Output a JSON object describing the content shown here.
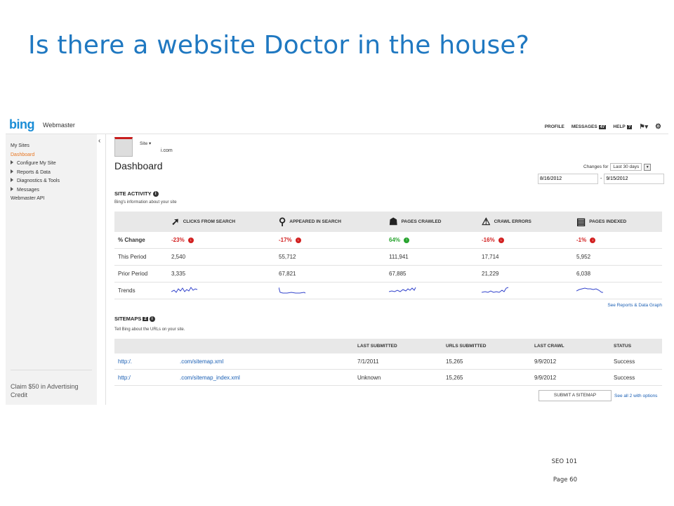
{
  "slide": {
    "title": "Is there a website Doctor in the house?",
    "footer_course": "SEO 101",
    "footer_page": "Page 60"
  },
  "topbar": {
    "logo": "bing",
    "product": "Webmaster",
    "profile": "PROFILE",
    "messages": "MESSAGES",
    "messages_count": "47",
    "help": "HELP",
    "help_badge": "?"
  },
  "sidebar": {
    "items": [
      {
        "label": "My Sites"
      },
      {
        "label": "Dashboard"
      },
      {
        "label": "Configure My Site"
      },
      {
        "label": "Reports & Data"
      },
      {
        "label": "Diagnostics & Tools"
      },
      {
        "label": "Messages"
      },
      {
        "label": "Webmaster API"
      }
    ],
    "claim": "Claim $50 in Advertising Credit"
  },
  "main": {
    "site_label": "Site",
    "site_url": "i.com",
    "page_title": "Dashboard",
    "changes_for": "Changes for",
    "range": "Last 30 days",
    "date_from": "8/16/2012",
    "date_sep": "-",
    "date_to": "9/15/2012"
  },
  "activity": {
    "title": "SITE ACTIVITY",
    "subtitle": "Bing's information about your site",
    "headers": [
      "CLICKS FROM SEARCH",
      "APPEARED IN SEARCH",
      "PAGES CRAWLED",
      "CRAWL ERRORS",
      "PAGES INDEXED"
    ],
    "header_icons": [
      "cursor-icon",
      "magnifier-icon",
      "robot-icon",
      "warning-icon",
      "document-icon"
    ],
    "rows": {
      "pct_label": "% Change",
      "pct": [
        "-23%",
        "-17%",
        "64%",
        "-16%",
        "-1%"
      ],
      "pct_dir": [
        "down",
        "down",
        "up",
        "down",
        "down"
      ],
      "this_label": "This Period",
      "this": [
        "2,540",
        "55,712",
        "111,941",
        "17,714",
        "5,952"
      ],
      "prior_label": "Prior Period",
      "prior": [
        "3,335",
        "67,821",
        "67,885",
        "21,229",
        "6,038"
      ],
      "trends_label": "Trends"
    },
    "see_reports": "See Reports & Data Graph"
  },
  "sitemaps": {
    "title": "SITEMAPS",
    "count": "2",
    "subtitle": "Tell Bing about the URLs on your site.",
    "headers": [
      "",
      "",
      "LAST SUBMITTED",
      "URLS SUBMITTED",
      "LAST CRAWL",
      "STATUS"
    ],
    "rows": [
      [
        "http:/.",
        ".com/sitemap.xml",
        "7/1/2011",
        "15,265",
        "9/9/2012",
        "Success"
      ],
      [
        "http:/",
        ".com/sitemap_index.xml",
        "Unknown",
        "15,265",
        "9/9/2012",
        "Success"
      ]
    ],
    "submit": "SUBMIT A SITEMAP",
    "see_all": "See all 2 with options"
  },
  "colors": {
    "title": "#1f78c1",
    "negative": "#d21f1f",
    "positive": "#27a32e",
    "link": "#1a5fb4",
    "active_nav": "#e87722"
  }
}
